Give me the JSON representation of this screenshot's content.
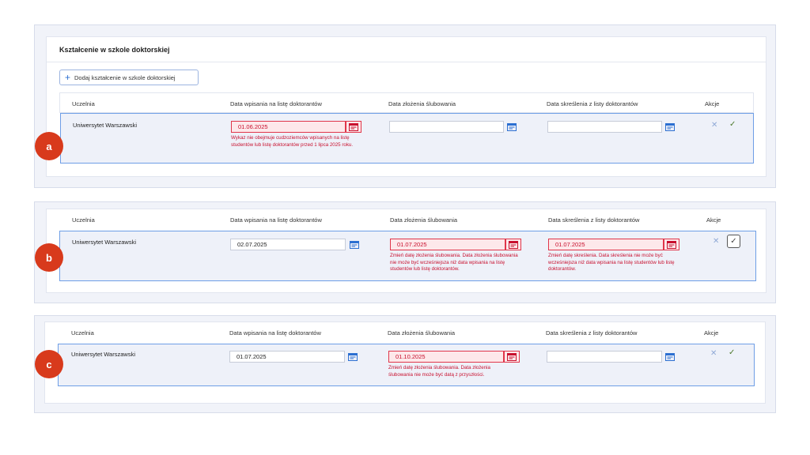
{
  "colors": {
    "accent": "#2c6fd1",
    "error": "#c8102e",
    "badge": "#d83a1c",
    "row_border": "#6e9ee6",
    "panel_bg": "#f1f3f9"
  },
  "panel_a": {
    "section_title": "Kształcenie w szkole doktorskiej",
    "add_button": "Dodaj kształcenie w szkole doktorskiej",
    "badge": "a",
    "headers": [
      "Uczelnia",
      "Data wpisania na listę doktorantów",
      "Data złożenia ślubowania",
      "Data skreślenia z listy doktorantów",
      "Akcje"
    ],
    "row": {
      "university": "Uniwersytet Warszawski",
      "enroll_date": "01.06.2025",
      "enroll_error": "Wykaz nie obejmuje cudzoziemców wpisanych na listę studentów lub listę doktorantów przed 1 lipca 2025 roku.",
      "oath_date": "",
      "removal_date": ""
    }
  },
  "panel_b": {
    "badge": "b",
    "headers": [
      "Uczelnia",
      "Data wpisania na listę doktorantów",
      "Data złożenia ślubowania",
      "Data skreślenia z listy doktorantów",
      "Akcje"
    ],
    "row": {
      "university": "Uniwersytet Warszawski",
      "enroll_date": "02.07.2025",
      "oath_date": "01.07.2025",
      "oath_error": "Zmień datę złożenia ślubowania. Data złożenia ślubowania nie może być wcześniejsza niż data wpisania na listę studentów lub listę doktorantów.",
      "removal_date": "01.07.2025",
      "removal_error": "Zmień datę skreślenia. Data skreślenia nie może być wcześniejsza niż data wpisania na listę studentów lub listę doktorantów."
    }
  },
  "panel_c": {
    "badge": "c",
    "headers": [
      "Uczelnia",
      "Data wpisania na listę doktorantów",
      "Data złożenia ślubowania",
      "Data skreślenia z listy doktorantów",
      "Akcje"
    ],
    "row": {
      "university": "Uniwersytet Warszawski",
      "enroll_date": "01.07.2025",
      "oath_date": "01.10.2025",
      "oath_error": "Zmień datę złożenia ślubowania. Data złożenia ślubowania nie może być datą z przyszłości.",
      "removal_date": ""
    }
  },
  "icons": {
    "calendar": "calendar-icon",
    "cancel": "close-icon",
    "confirm": "check-icon",
    "add": "plus-icon"
  }
}
